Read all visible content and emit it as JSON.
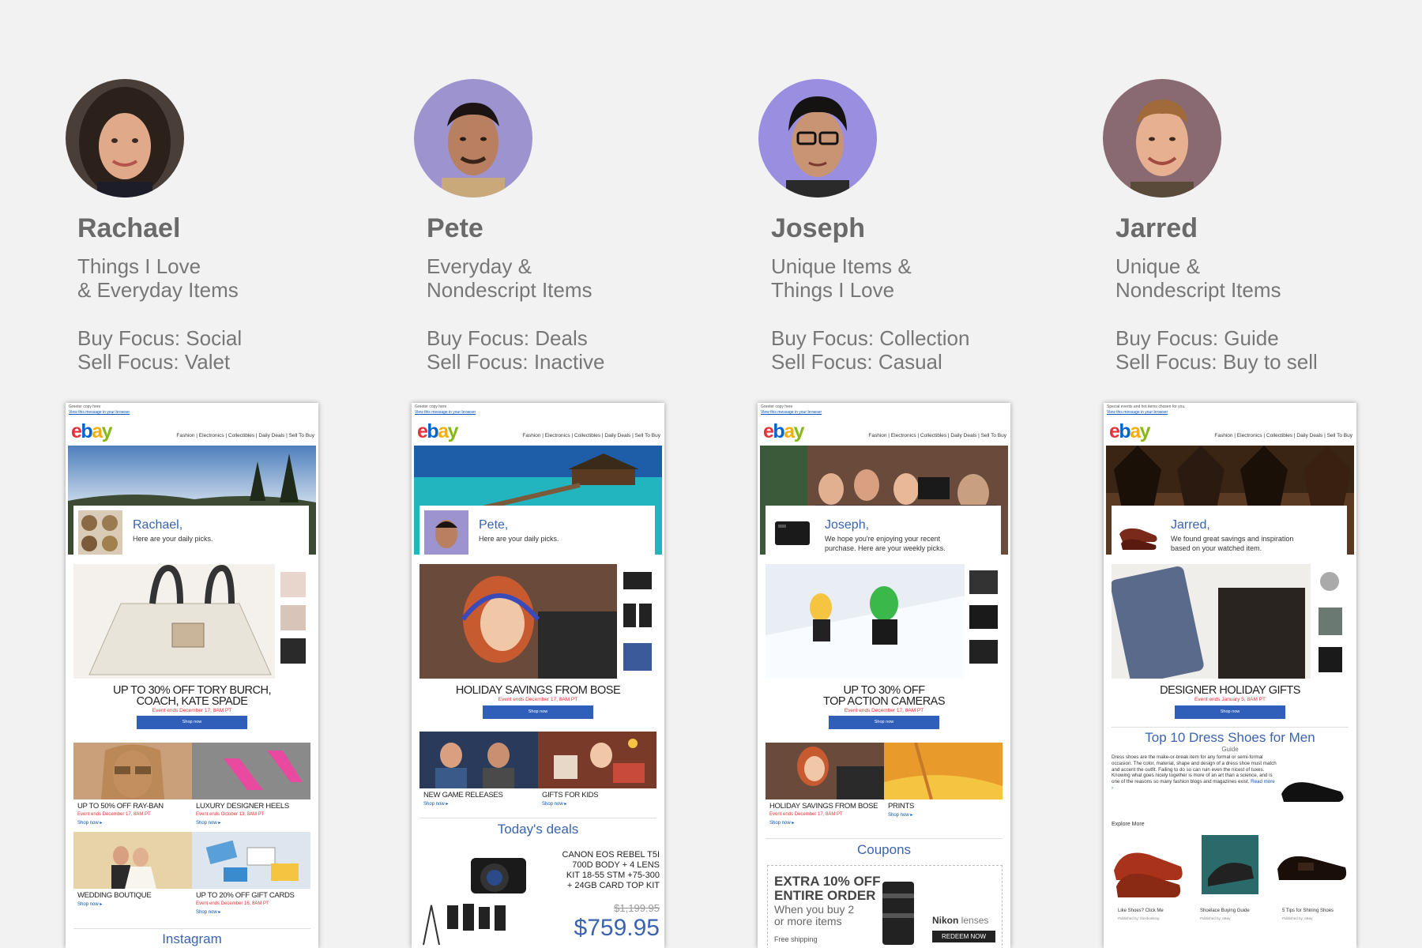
{
  "personas": [
    {
      "name": "Rachael",
      "interest_line1": "Things I Love",
      "interest_line2": "& Everyday Items",
      "buy_focus": "Buy Focus: Social",
      "sell_focus": "Sell Focus: Valet"
    },
    {
      "name": "Pete",
      "interest_line1": "Everyday &",
      "interest_line2": "Nondescript Items",
      "buy_focus": "Buy Focus: Deals",
      "sell_focus": "Sell Focus: Inactive"
    },
    {
      "name": "Joseph",
      "interest_line1": "Unique Items &",
      "interest_line2": "Things I Love",
      "buy_focus": "Buy Focus: Collection",
      "sell_focus": "Sell Focus: Casual"
    },
    {
      "name": "Jarred",
      "interest_line1": "Unique &",
      "interest_line2": "Nondescript Items",
      "buy_focus": "Buy Focus: Guide",
      "sell_focus": "Sell Focus: Buy to sell"
    }
  ],
  "email_common": {
    "preheader": "Greeter copy here",
    "preheader_jarred": "Special events and hot items chosen for you.",
    "view_browser": "View this message in your browser",
    "logo": {
      "e": "e",
      "b": "b",
      "a": "a",
      "y": "y"
    },
    "nav": "Fashion  |  Electronics  |  Collectibles  |  Daily Deals  |  Sell To Buy",
    "shop_now_button": "Shop now",
    "shop_now_link": "Shop now ▸"
  },
  "emails": {
    "rachael": {
      "greeting": "Rachael,",
      "greeting_sub": "Here are your daily picks.",
      "feature_line1": "UP TO 30% OFF TORY BURCH,",
      "feature_line2": "COACH, KATE SPADE",
      "feature_event": "Event ends December 17, 8AM PT",
      "tiles": [
        {
          "title": "UP TO 50% OFF RAY-BAN",
          "event": "Event ends December 17, 8AM PT"
        },
        {
          "title": "LUXURY DESIGNER HEELS",
          "event": "Event ends October 13, 8AM PT"
        },
        {
          "title": "WEDDING BOUTIQUE",
          "event": ""
        },
        {
          "title": "UP TO 20% OFF GIFT CARDS",
          "event": "Event ends December 16, 8AM PT"
        }
      ],
      "section": "Instagram"
    },
    "pete": {
      "greeting": "Pete,",
      "greeting_sub": "Here are your daily picks.",
      "feature_line1": "HOLIDAY SAVINGS FROM BOSE",
      "feature_event": "Event ends December 17, 8AM PT",
      "tiles": [
        {
          "title": "NEW GAME RELEASES"
        },
        {
          "title": "GIFTS FOR KIDS"
        }
      ],
      "section": "Today's deals",
      "deal_line1": "CANON EOS REBEL T5I",
      "deal_line2": "700D BODY + 4 LENS",
      "deal_line3": "KIT 18-55 STM +75-300",
      "deal_line4": "+ 24GB CARD TOP KIT",
      "old_price": "$1,199.95",
      "price": "$759.95"
    },
    "joseph": {
      "greeting": "Joseph,",
      "greeting_sub1": "We hope you're enjoying your recent",
      "greeting_sub2": "purchase. Here are your weekly picks.",
      "feature_line1": "UP TO 30% OFF",
      "feature_line2": "TOP ACTION CAMERAS",
      "feature_event": "Event ends December 17, 8AM PT",
      "tiles": [
        {
          "title": "HOLIDAY SAVINGS FROM BOSE",
          "event": "Event ends December 17, 8AM PT"
        },
        {
          "title": "PRINTS",
          "event": ""
        }
      ],
      "section": "Coupons",
      "coupon_line1": "EXTRA 10% OFF",
      "coupon_line2": "ENTIRE ORDER",
      "coupon_line3": "When you buy 2",
      "coupon_line4": "or more items",
      "coupon_brand": "Nikon",
      "coupon_brand_suffix": " lenses",
      "coupon_button": "REDEEM NOW",
      "coupon_shipping": "Free shipping"
    },
    "jarred": {
      "greeting": "Jarred,",
      "greeting_sub1": "We found great savings and inspiration",
      "greeting_sub2": "based on your watched item.",
      "feature_line1": "DESIGNER HOLIDAY GIFTS",
      "feature_event": "Event ends January 5, 8AM PT",
      "section": "Top 10 Dress Shoes for Men",
      "section_sub": "Guide",
      "guide_text": "Dress shoes are the make-or-break item for any formal or semi-formal occasion. The color, material, shape and design of a dress shoe must match and accent the outfit. Failing to do so can ruin even the nicest of tuxes. Knowing what goes nicely together is more of an art than a science, and is one of the reasons so many fashion blogs and magazines exist.",
      "read_more": "Read more ›",
      "explore": "Explore More",
      "explore_items": [
        {
          "title": "Like Shoes? Click Me",
          "by": "Published by: theshoeking"
        },
        {
          "title": "Shoelace Buying Guide",
          "by": "Published by: eBay"
        },
        {
          "title": "5 Tips for Shining Shoes",
          "by": "Published by: eBay"
        }
      ]
    }
  }
}
